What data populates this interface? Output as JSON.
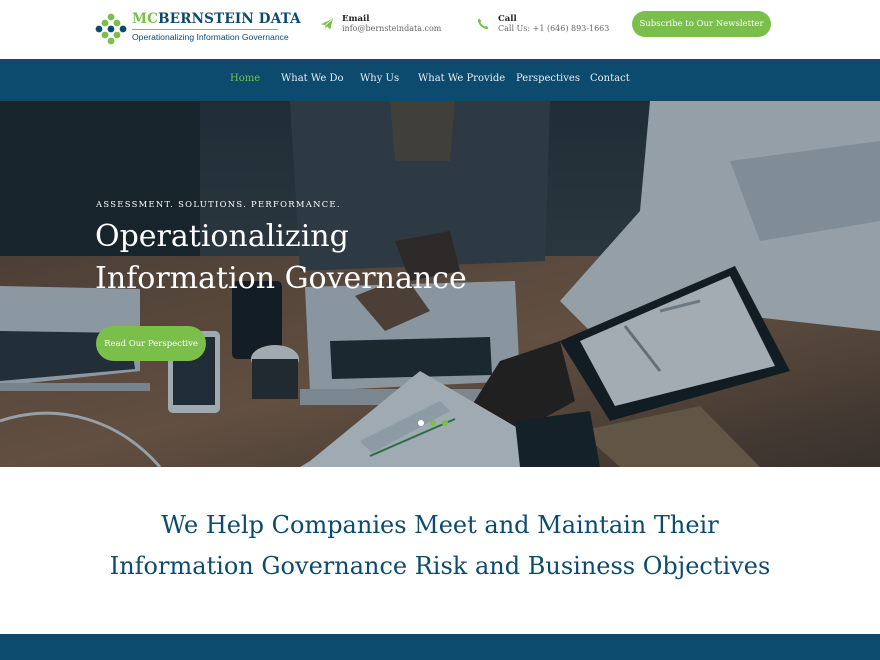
{
  "colors": {
    "brand_navy": "#0c4a6e",
    "brand_green": "#7bbf4b",
    "white": "#ffffff"
  },
  "header": {
    "logo": {
      "name_prefix": "MC",
      "name_rest": "BERNSTEIN DATA",
      "tagline": "Operationalizing Information Governance",
      "icon": "diamond-dots-logo-icon"
    },
    "email": {
      "icon": "paper-plane-icon",
      "label": "Email",
      "value": "info@bernsteindata.com"
    },
    "call": {
      "icon": "phone-icon",
      "label": "Call",
      "value": "Call Us: +1 (646) 893-1663"
    },
    "subscribe_label": "Subscribe to Our Newsletter"
  },
  "nav": {
    "items": [
      {
        "label": "Home",
        "active": true
      },
      {
        "label": "What We Do",
        "active": false
      },
      {
        "label": "Why Us",
        "active": false
      },
      {
        "label": "What We Provide",
        "active": false
      },
      {
        "label": "Perspectives",
        "active": false
      },
      {
        "label": "Contact",
        "active": false
      }
    ]
  },
  "hero": {
    "kicker": "ASSESSMENT. SOLUTIONS. PERFORMANCE.",
    "title_line1": "Operationalizing",
    "title_line2": "Information Governance",
    "button_label": "Read Our Perspective",
    "slides": 3,
    "active_slide": 1
  },
  "headline": {
    "line1": "We Help Companies Meet and Maintain Their",
    "line2": "Information Governance Risk and Business Objectives"
  }
}
